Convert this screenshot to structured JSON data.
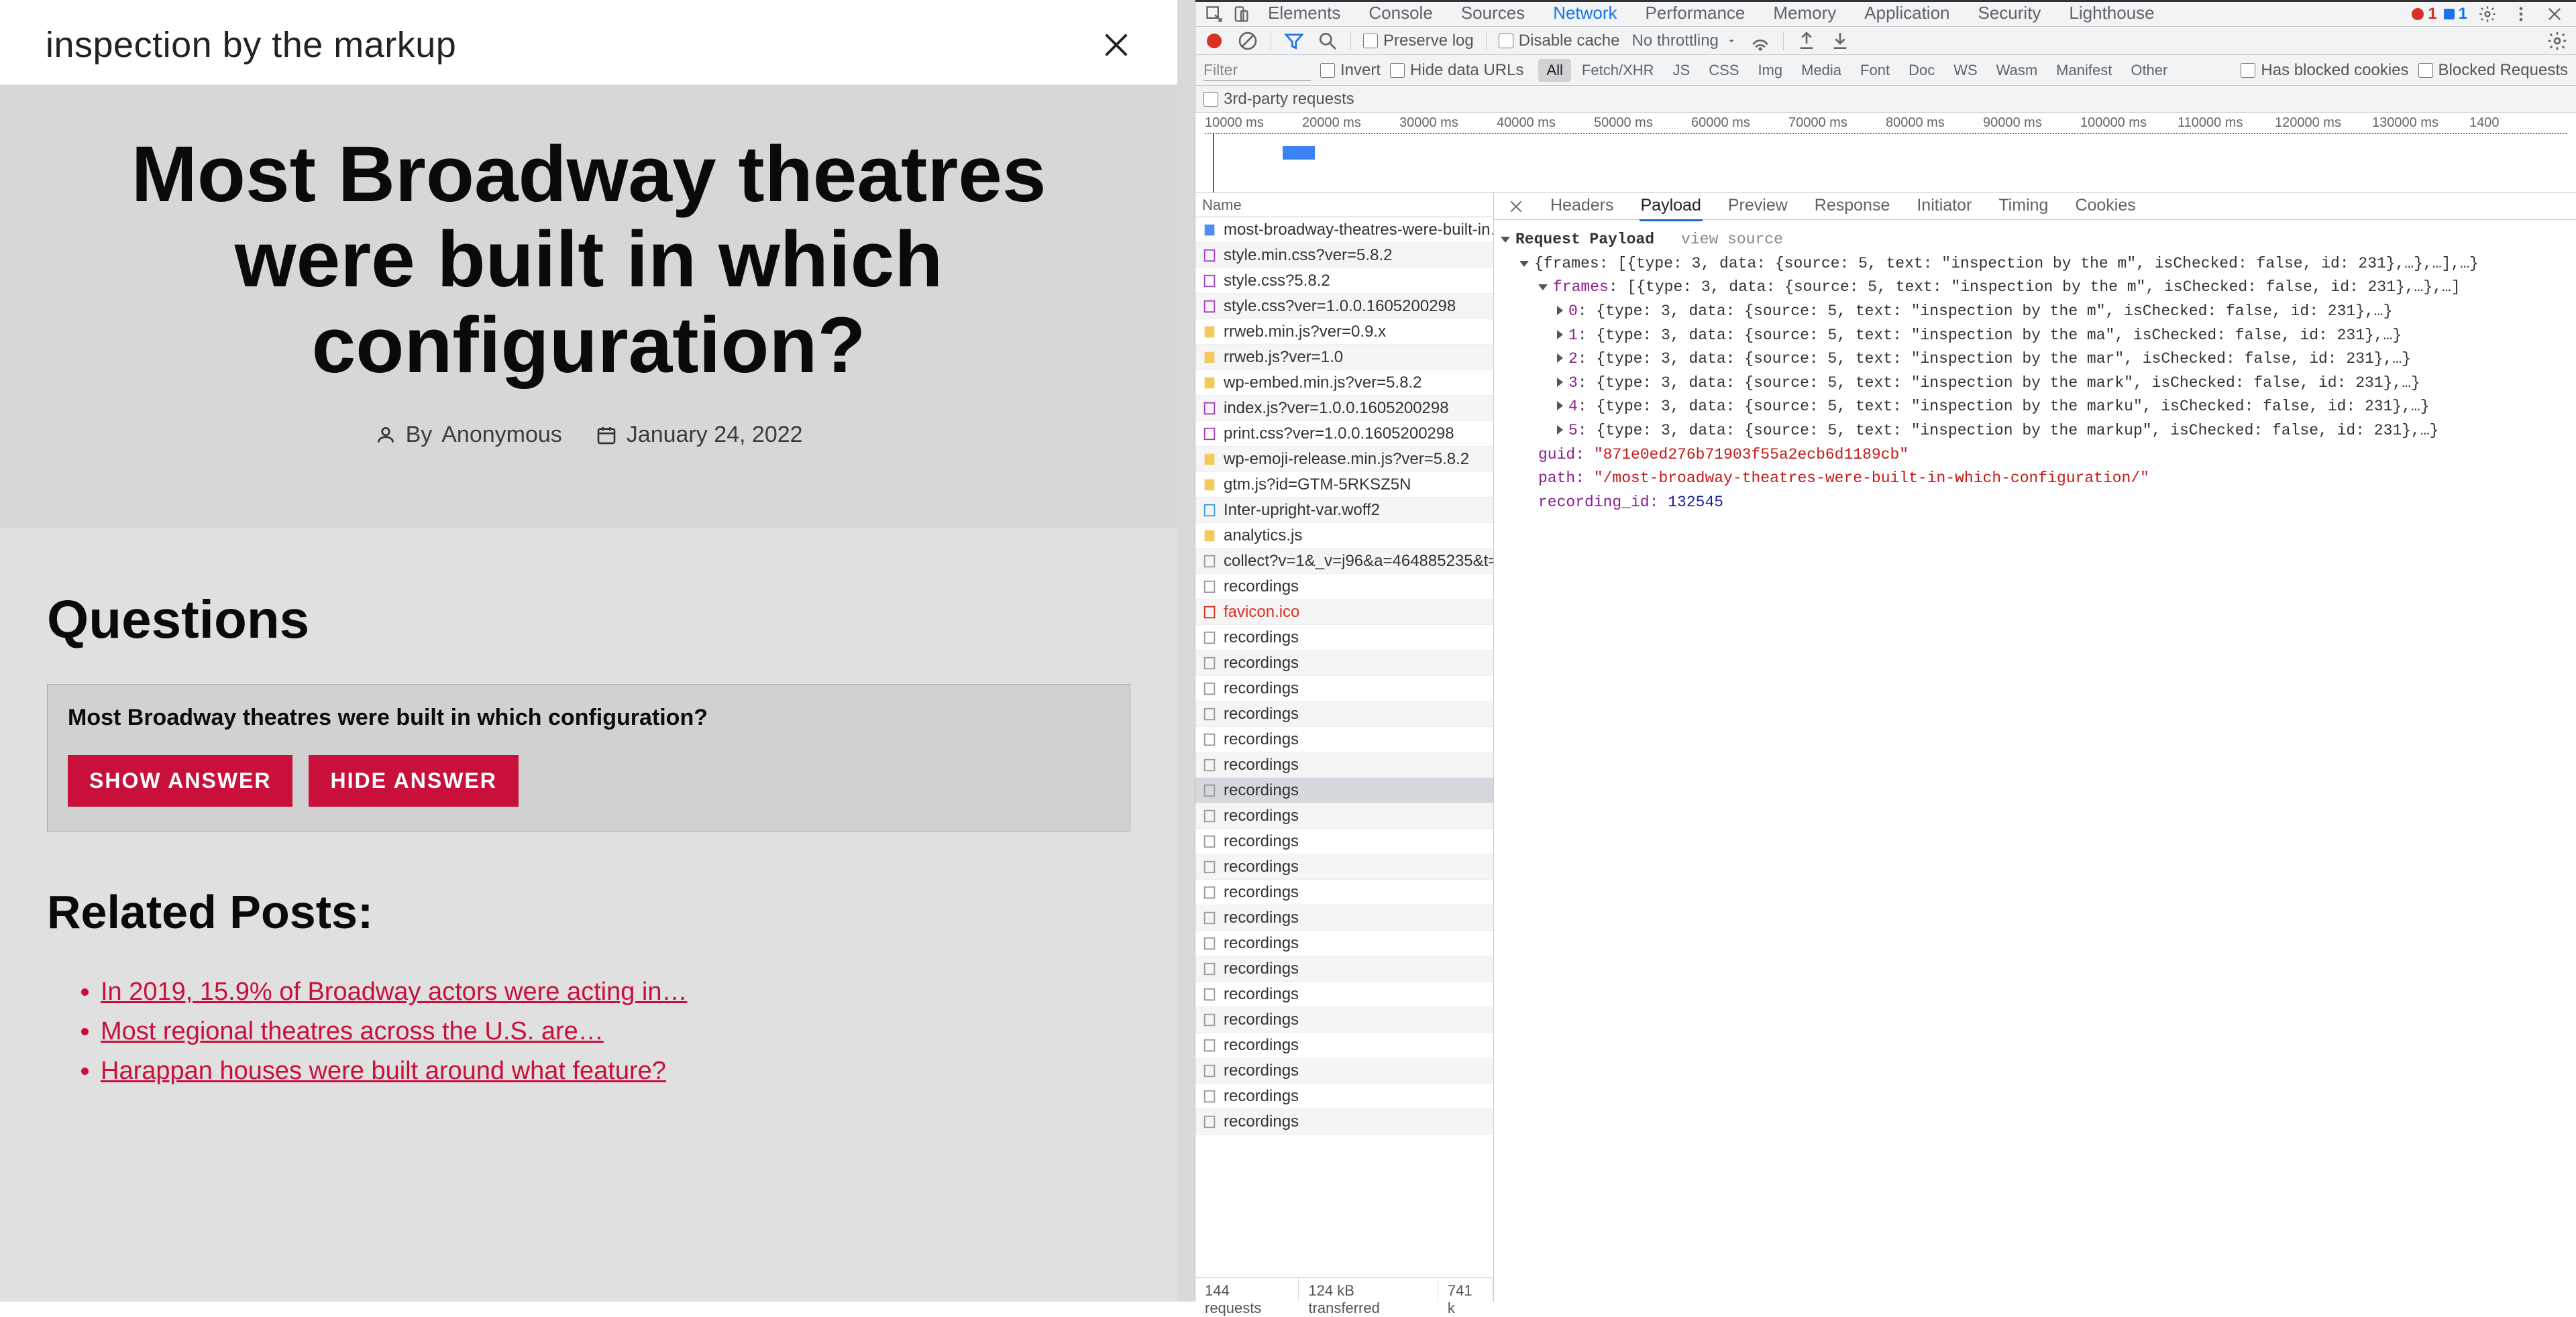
{
  "page": {
    "search_text": "inspection by the markup",
    "headline": "Most Broadway theatres were built in which configuration?",
    "byline_prefix": "By",
    "byline_author": "Anonymous",
    "post_date": "January 24, 2022",
    "questions_heading": "Questions",
    "question_text": "Most Broadway theatres were built in which configuration?",
    "show_answer": "SHOW ANSWER",
    "hide_answer": "HIDE ANSWER",
    "related_heading": "Related Posts:",
    "related_posts": [
      "In 2019, 15.9% of Broadway actors were acting in…",
      "Most regional theatres across the U.S. are…",
      "Harappan houses were built around what feature?"
    ]
  },
  "devtools": {
    "tabs": [
      "Elements",
      "Console",
      "Sources",
      "Network",
      "Performance",
      "Memory",
      "Application",
      "Security",
      "Lighthouse"
    ],
    "active_tab": "Network",
    "badges": {
      "errors": "1",
      "info": "1"
    },
    "tb2": {
      "preserve_log": "Preserve log",
      "disable_cache": "Disable cache",
      "throttle": "No throttling"
    },
    "filter": {
      "placeholder": "Filter",
      "invert": "Invert",
      "hide_data_urls": "Hide data URLs",
      "pills": [
        "All",
        "Fetch/XHR",
        "JS",
        "CSS",
        "Img",
        "Media",
        "Font",
        "Doc",
        "WS",
        "Wasm",
        "Manifest",
        "Other"
      ],
      "blocked_cookies": "Has blocked cookies",
      "blocked_requests": "Blocked Requests",
      "third_party": "3rd-party requests"
    },
    "overview_ticks": [
      "10000 ms",
      "20000 ms",
      "30000 ms",
      "40000 ms",
      "50000 ms",
      "60000 ms",
      "70000 ms",
      "80000 ms",
      "90000 ms",
      "100000 ms",
      "110000 ms",
      "120000 ms",
      "130000 ms",
      "1400"
    ],
    "req_header": "Name",
    "requests": [
      {
        "icon": "doc-blue",
        "name": "most-broadway-theatres-were-built-in…"
      },
      {
        "icon": "css",
        "name": "style.min.css?ver=5.8.2"
      },
      {
        "icon": "css",
        "name": "style.css?5.8.2"
      },
      {
        "icon": "css",
        "name": "style.css?ver=1.0.0.1605200298"
      },
      {
        "icon": "js",
        "name": "rrweb.min.js?ver=0.9.x"
      },
      {
        "icon": "js",
        "name": "rrweb.js?ver=1.0"
      },
      {
        "icon": "js",
        "name": "wp-embed.min.js?ver=5.8.2"
      },
      {
        "icon": "css",
        "name": "index.js?ver=1.0.0.1605200298"
      },
      {
        "icon": "css",
        "name": "print.css?ver=1.0.0.1605200298"
      },
      {
        "icon": "js",
        "name": "wp-emoji-release.min.js?ver=5.8.2"
      },
      {
        "icon": "js",
        "name": "gtm.js?id=GTM-5RKSZ5N"
      },
      {
        "icon": "font",
        "name": "Inter-upright-var.woff2"
      },
      {
        "icon": "js",
        "name": "analytics.js"
      },
      {
        "icon": "doc",
        "name": "collect?v=1&_v=j96&a=464885235&t=…"
      },
      {
        "icon": "doc",
        "name": "recordings"
      },
      {
        "icon": "fav",
        "name": "favicon.ico"
      },
      {
        "icon": "doc",
        "name": "recordings"
      },
      {
        "icon": "doc",
        "name": "recordings"
      },
      {
        "icon": "doc",
        "name": "recordings"
      },
      {
        "icon": "doc",
        "name": "recordings"
      },
      {
        "icon": "doc",
        "name": "recordings"
      },
      {
        "icon": "doc",
        "name": "recordings"
      },
      {
        "icon": "doc",
        "name": "recordings",
        "selected": true
      },
      {
        "icon": "doc",
        "name": "recordings"
      },
      {
        "icon": "doc",
        "name": "recordings"
      },
      {
        "icon": "doc",
        "name": "recordings"
      },
      {
        "icon": "doc",
        "name": "recordings"
      },
      {
        "icon": "doc",
        "name": "recordings"
      },
      {
        "icon": "doc",
        "name": "recordings"
      },
      {
        "icon": "doc",
        "name": "recordings"
      },
      {
        "icon": "doc",
        "name": "recordings"
      },
      {
        "icon": "doc",
        "name": "recordings"
      },
      {
        "icon": "doc",
        "name": "recordings"
      },
      {
        "icon": "doc",
        "name": "recordings"
      },
      {
        "icon": "doc",
        "name": "recordings"
      },
      {
        "icon": "doc",
        "name": "recordings"
      }
    ],
    "status_bar": [
      "144 requests",
      "124 kB transferred",
      "741 k"
    ],
    "detail_tabs": [
      "Headers",
      "Payload",
      "Preview",
      "Response",
      "Initiator",
      "Timing",
      "Cookies"
    ],
    "detail_active": "Payload",
    "payload": {
      "title": "Request Payload",
      "view_source": "view source",
      "top": "{frames: [{type: 3, data: {source: 5, text: \"inspection by the m\", isChecked: false, id: 231},…},…],…}",
      "frames_line": "[{type: 3, data: {source: 5, text: \"inspection by the m\", isChecked: false, id: 231},…},…]",
      "frame_items": [
        "{type: 3, data: {source: 5, text: \"inspection by the m\", isChecked: false, id: 231},…}",
        "{type: 3, data: {source: 5, text: \"inspection by the ma\", isChecked: false, id: 231},…}",
        "{type: 3, data: {source: 5, text: \"inspection by the mar\", isChecked: false, id: 231},…}",
        "{type: 3, data: {source: 5, text: \"inspection by the mark\", isChecked: false, id: 231},…}",
        "{type: 3, data: {source: 5, text: \"inspection by the marku\", isChecked: false, id: 231},…}",
        "{type: 3, data: {source: 5, text: \"inspection by the markup\", isChecked: false, id: 231},…}"
      ],
      "guid_k": "guid:",
      "guid_v": "\"871e0ed276b71903f55a2ecb6d1189cb\"",
      "path_k": "path:",
      "path_v": "\"/most-broadway-theatres-were-built-in-which-configuration/\"",
      "rec_k": "recording_id:",
      "rec_v": "132545"
    }
  }
}
